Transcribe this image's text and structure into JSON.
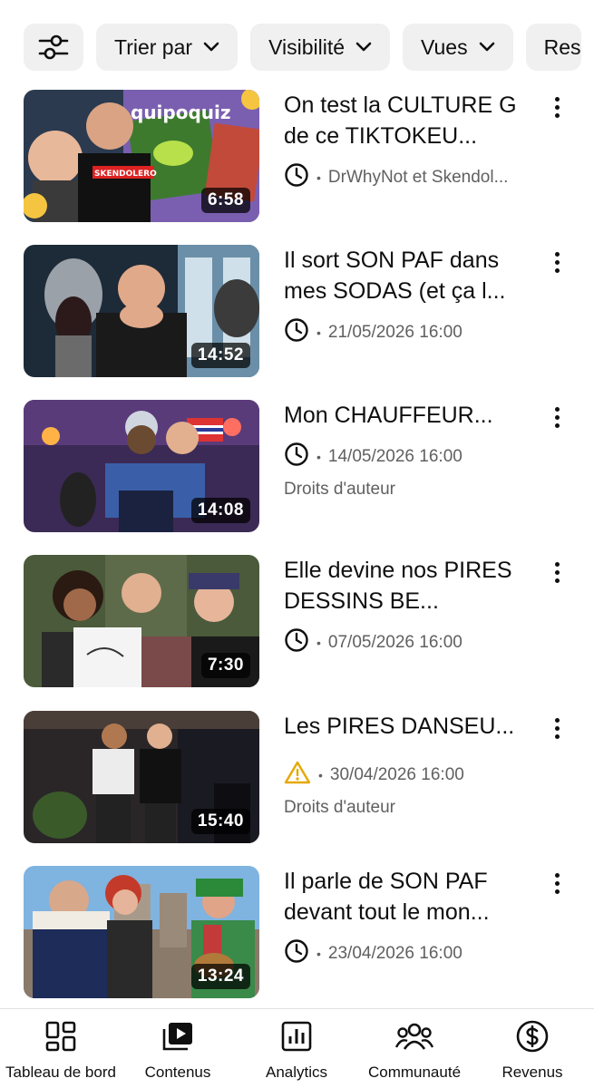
{
  "filters": {
    "sort_label": "Trier par",
    "visibility_label": "Visibilité",
    "views_label": "Vues",
    "restrictions_label": "Res"
  },
  "videos": [
    {
      "title": "On test la CULTURE G de ce TIKTOKEU...",
      "duration": "6:58",
      "status_icon": "clock-icon",
      "meta": "DrWhyNot et Skendol...",
      "extra": "",
      "thumb_texts": [
        "quipoquiz",
        "SKENDOLERO"
      ]
    },
    {
      "title": "Il sort SON PAF dans mes SODAS (et ça l...",
      "duration": "14:52",
      "status_icon": "clock-icon",
      "meta": "21/05/2026 16:00",
      "extra": ""
    },
    {
      "title": "Mon CHAUFFEUR...",
      "duration": "14:08",
      "status_icon": "clock-icon",
      "meta": "14/05/2026 16:00",
      "extra": "Droits d'auteur"
    },
    {
      "title": "Elle devine nos PIRES DESSINS BE...",
      "duration": "7:30",
      "status_icon": "clock-icon",
      "meta": "07/05/2026 16:00",
      "extra": ""
    },
    {
      "title": "Les PIRES DANSEU...",
      "duration": "15:40",
      "status_icon": "warning-icon",
      "meta": "30/04/2026 16:00",
      "extra": "Droits d'auteur"
    },
    {
      "title": "Il parle de SON PAF devant tout le mon...",
      "duration": "13:24",
      "status_icon": "clock-icon",
      "meta": "23/04/2026 16:00",
      "extra": ""
    }
  ],
  "nav": {
    "dashboard": "Tableau de bord",
    "content": "Contenus",
    "analytics": "Analytics",
    "community": "Communauté",
    "earn": "Revenus"
  },
  "colors": {
    "chip_bg": "#f0f0f0",
    "meta_gray": "#606060",
    "warning": "#e6a800"
  }
}
